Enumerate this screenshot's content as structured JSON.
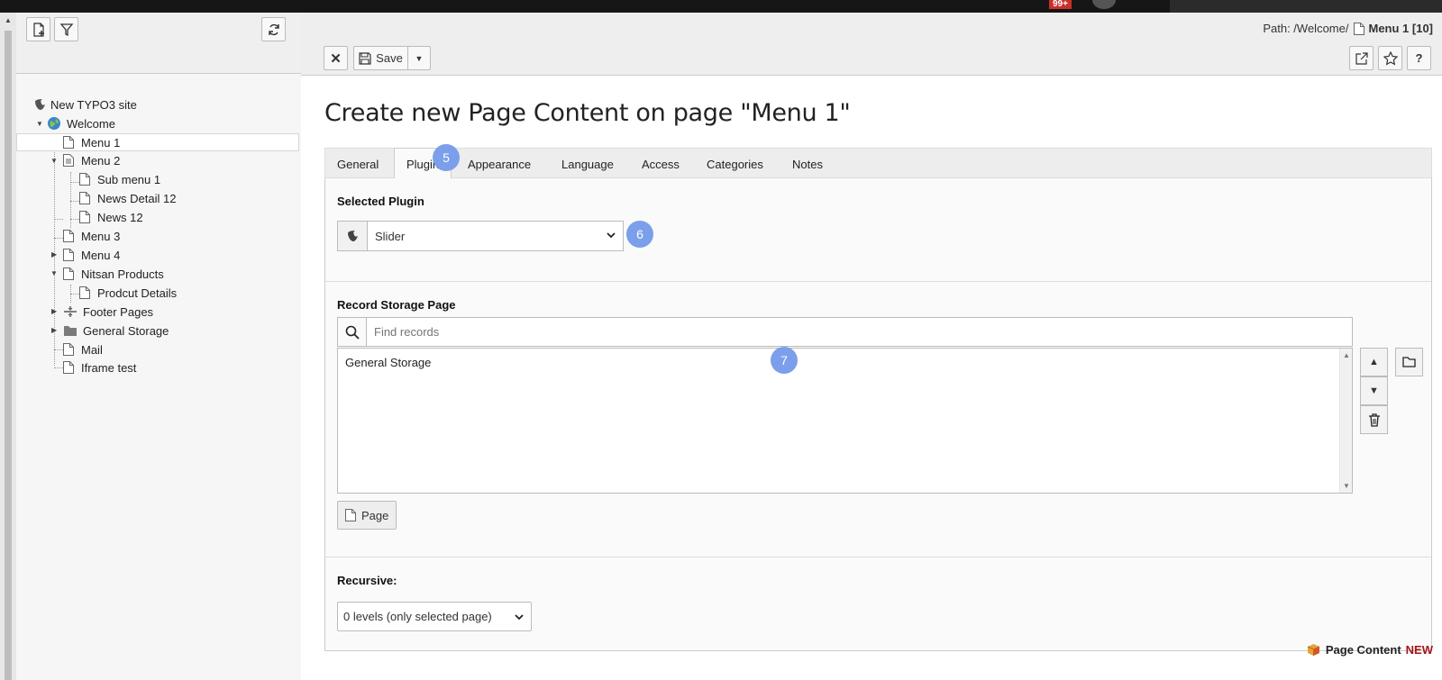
{
  "topbar": {
    "notification_count": "99+"
  },
  "sidebar": {
    "tree": {
      "root": "New TYPO3 site",
      "items": [
        {
          "label": "Welcome"
        },
        {
          "label": "Menu 1"
        },
        {
          "label": "Menu 2"
        },
        {
          "label": "Sub menu 1"
        },
        {
          "label": "News Detail 12"
        },
        {
          "label": "News 12"
        },
        {
          "label": "Menu 3"
        },
        {
          "label": "Menu 4"
        },
        {
          "label": "Nitsan Products"
        },
        {
          "label": "Prodcut Details"
        },
        {
          "label": "Footer Pages"
        },
        {
          "label": "General Storage"
        },
        {
          "label": "Mail"
        },
        {
          "label": "Iframe test"
        }
      ]
    }
  },
  "docheader": {
    "path_label": "Path: /Welcome/",
    "path_page": "Menu 1 [10]",
    "save_label": "Save"
  },
  "main": {
    "title": "Create new Page Content on page \"Menu 1\"",
    "tabs": [
      {
        "label": "General"
      },
      {
        "label": "Plugin"
      },
      {
        "label": "Appearance"
      },
      {
        "label": "Language"
      },
      {
        "label": "Access"
      },
      {
        "label": "Categories"
      },
      {
        "label": "Notes"
      }
    ],
    "selected_plugin": {
      "label": "Selected Plugin",
      "value": "Slider"
    },
    "record_storage": {
      "label": "Record Storage Page",
      "placeholder": "Find records",
      "items": [
        "General Storage"
      ],
      "page_button": "Page"
    },
    "recursive": {
      "label": "Recursive:",
      "value": "0 levels (only selected page)"
    },
    "record_type": {
      "label": "Page Content",
      "status": "NEW"
    }
  },
  "callouts": {
    "tab": "5",
    "plugin_select": "6",
    "storage_item": "7"
  },
  "colors": {
    "callout": "#7b9fea",
    "new_status": "#a4161a",
    "badge": "#c8302c"
  }
}
